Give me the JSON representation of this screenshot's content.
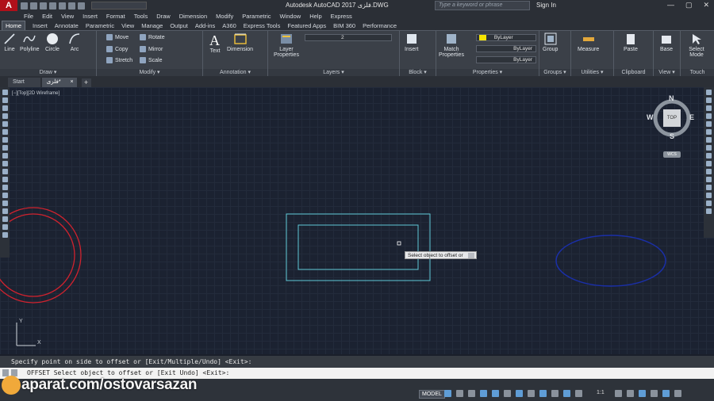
{
  "titlebar": {
    "logo": "A",
    "title": "Autodesk AutoCAD 2017  فلزی.DWG",
    "search_placeholder": "Type a keyword or phrase",
    "signin": "Sign In",
    "controls": [
      "—",
      "▢",
      "✕"
    ]
  },
  "menu": [
    "File",
    "Edit",
    "View",
    "Insert",
    "Format",
    "Tools",
    "Draw",
    "Dimension",
    "Modify",
    "Parametric",
    "Window",
    "Help",
    "Express"
  ],
  "ribbon_tabs": [
    "Home",
    "Insert",
    "Annotate",
    "Parametric",
    "View",
    "Manage",
    "Output",
    "Add-ins",
    "A360",
    "Express Tools",
    "Featured Apps",
    "BIM 360",
    "Performance"
  ],
  "panels": {
    "draw": {
      "title": "Draw ▾",
      "tools": [
        "Line",
        "Polyline",
        "Circle",
        "Arc"
      ]
    },
    "modify": {
      "title": "Modify ▾",
      "tools": [
        "Move",
        "Rotate",
        "Copy",
        "Mirror",
        "Stretch",
        "Scale"
      ]
    },
    "annotation": {
      "title": "Annotation ▾",
      "tools": [
        "Text",
        "Dimension"
      ]
    },
    "layers": {
      "title": "Layers ▾",
      "tool": "Layer Properties",
      "current_layer": "2"
    },
    "block": {
      "title": "Block ▾",
      "tool": "Insert"
    },
    "properties": {
      "title": "Properties ▾",
      "tool": "Match Properties",
      "color": "ByLayer",
      "linetype": "ByLayer",
      "lineweight": "ByLayer"
    },
    "groups": {
      "title": "Groups ▾",
      "tool": "Group"
    },
    "utilities": {
      "title": "Utilities ▾",
      "tool": "Measure"
    },
    "clipboard": {
      "title": "Clipboard",
      "tool": "Paste"
    },
    "view": {
      "title": "View ▾",
      "tool": "Base"
    },
    "touch": {
      "title": "Touch",
      "tool": "Select Mode"
    }
  },
  "doc_tabs": [
    {
      "label": "Start"
    },
    {
      "label": "فلزی*"
    }
  ],
  "viewport_label": "[−][Top][2D Wireframe]",
  "viewcube": {
    "n": "N",
    "s": "S",
    "e": "E",
    "w": "W",
    "face": "TOP",
    "ucs": "WCS"
  },
  "ucs_icon": {
    "x": "X",
    "y": "Y"
  },
  "tooltip": "Select object to offset or",
  "command_history": "Specify point on side to offset or [Exit/Multiple/Undo] <Exit>:",
  "command_line": "OFFSET Select object to offset or [Exit Undo] <Exit>:",
  "watermark": "aparat.com/ostovarsazan",
  "status": {
    "model": "MODEL",
    "scale": "1:1"
  },
  "colors": {
    "circle": "#d0222e",
    "rect": "#5fc8d6",
    "ellipse": "#1a2fa8",
    "bylayer_swatch": "#f5e400"
  }
}
